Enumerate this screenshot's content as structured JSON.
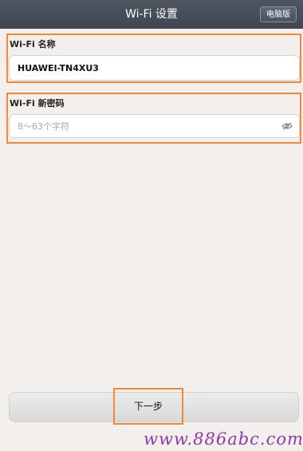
{
  "header": {
    "title": "Wi-Fi 设置",
    "pc_version_label": "电脑版"
  },
  "wifi_name": {
    "label": "Wi-Fi 名称",
    "value": "HUAWEI-TN4XU3"
  },
  "wifi_password": {
    "label": "Wi-Fi 新密码",
    "placeholder": "8～63个字符",
    "toggle_icon": "eye-slash-icon"
  },
  "footer": {
    "next_label": "下一步"
  },
  "watermark": {
    "text": "www.886abc.com"
  },
  "colors": {
    "header_bg": "#464e59",
    "page_bg": "#f3efec",
    "highlight": "#f08a3a",
    "watermark": "#8c3aa8"
  }
}
